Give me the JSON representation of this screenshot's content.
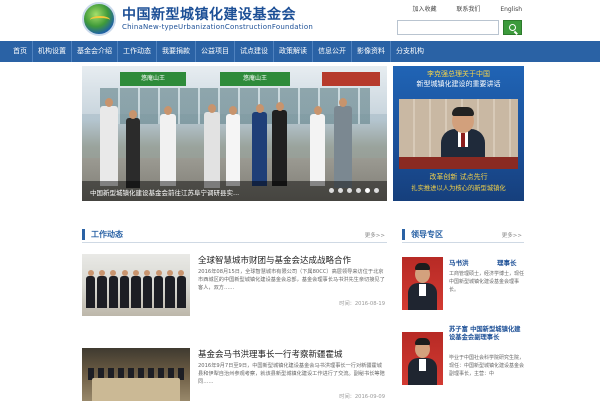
{
  "site": {
    "name_cn": "中国新型城镇化建设基金会",
    "name_en": "ChinaNew-typeUrbanizationConstructionFoundation"
  },
  "toplinks": [
    "加入收藏",
    "联系我们",
    "English"
  ],
  "nav": [
    "首页",
    "机构设置",
    "基金会介绍",
    "工作动态",
    "我要捐款",
    "公益项目",
    "试点建设",
    "政策解读",
    "信息公开",
    "影像资料",
    "分支机构"
  ],
  "banner": {
    "shop_sign_1": "悠庵山王",
    "shop_sign_2": "悠庵山王",
    "caption": "中国新型城镇化建设基金会前往江苏阜宁调研县实...",
    "slide_count": 6,
    "active_slide": 5
  },
  "promo": {
    "line1": "李克强总理关于中国",
    "line2": "新型城镇化建设的重要讲话",
    "line3": "",
    "slogan1": "改革创新 试点先行",
    "slogan2": "扎实推进以人为核心的新型城镇化"
  },
  "news_section": {
    "title": "工作动态",
    "more": "更多>>"
  },
  "news": [
    {
      "title": "全球智慧城市财团与基金会达成战略合作",
      "body": "2016年08月15日，全球智慧城市有限公司（下属80CC）高层领导来访位于北京市西城区的中国新型城镇化建设基金会总部，基金会理事长马书洪先生亲切接见了客人，双方……",
      "date": "时间：2016-08-19"
    },
    {
      "title": "基金会马书洪理事长一行考察新疆霍城",
      "body": "2016年9月7日至9日，中国新型城镇化建设基金会马书洪理事长一行对新疆霍城县和伊犁自治州参观考察，就该县新型城镇化建设工作进行了交流。副秘书长等陪同……",
      "date": "时间：2016-09-09"
    }
  ],
  "leader_section": {
    "title": "领导专区",
    "more": "更多>>"
  },
  "leaders": [
    {
      "name": "马书洪",
      "role": "理事长",
      "desc": "工商管理硕士，经济学博士，现任中国新型城镇化建设基金会理事长。"
    },
    {
      "name": "苏子富 中国新型城镇化建设基金会副理事长",
      "desc": "毕业于中国社会科学院研究生院，现任：中国新型城镇化建设基金会副理事长，主营：中"
    }
  ],
  "search": {
    "placeholder": ""
  },
  "colors": {
    "nav_bg": "#2a62a5",
    "brand_blue": "#1c4f96",
    "search_btn": "#3c9a3b"
  }
}
